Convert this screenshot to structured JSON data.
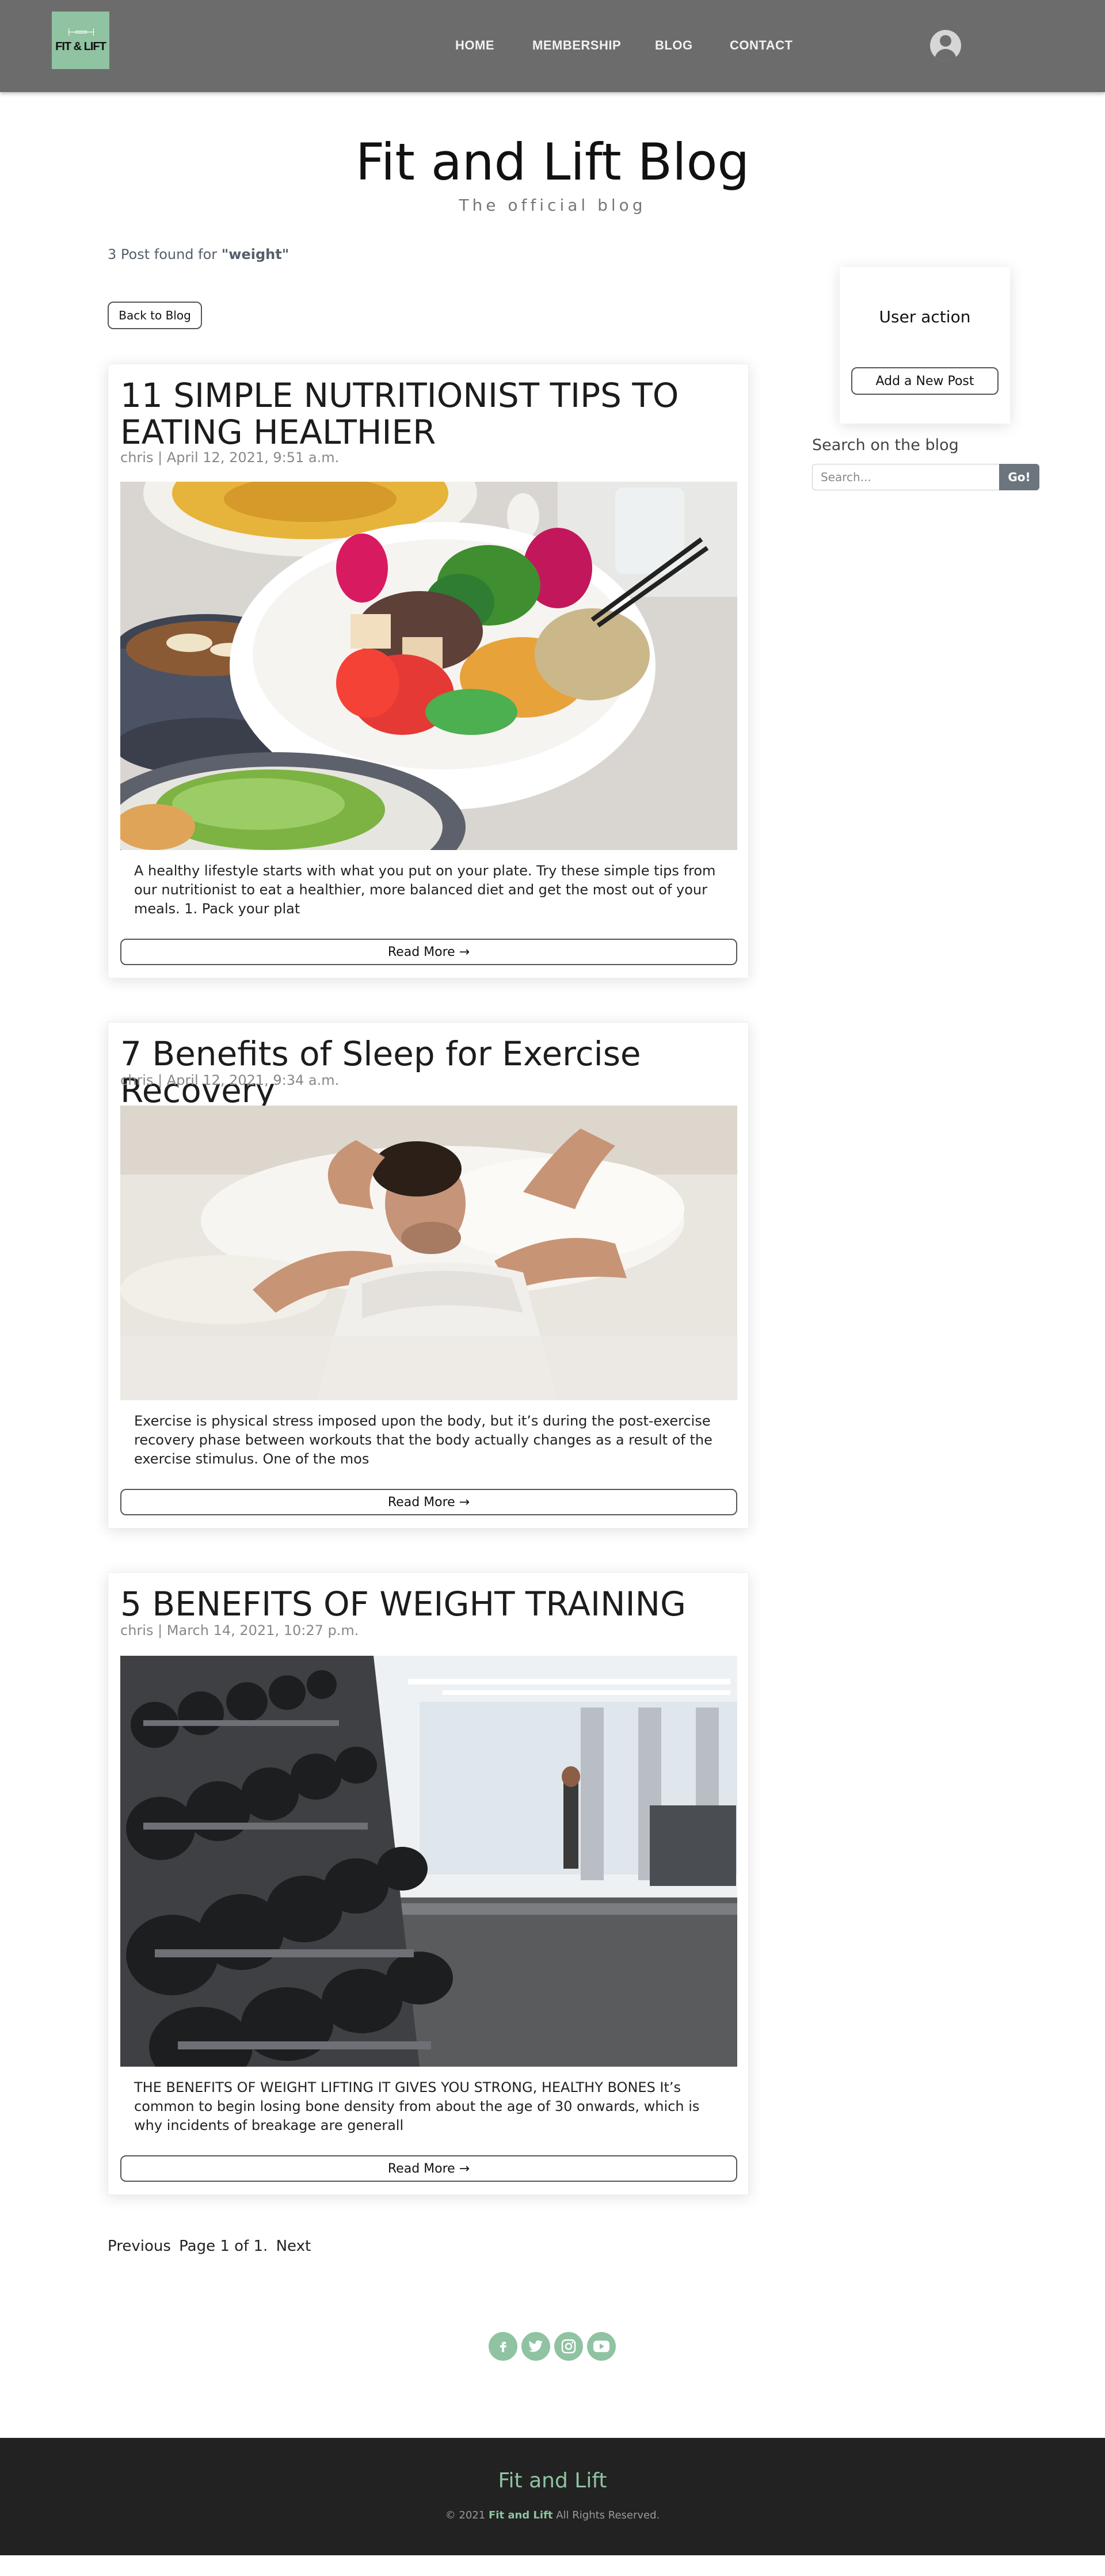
{
  "navbar": {
    "logo_text": "FIT & LIFT",
    "links": [
      "HOME",
      "MEMBERSHIP",
      "BLOG",
      "CONTACT"
    ]
  },
  "header": {
    "title": "Fit and Lift Blog",
    "subtitle": "The official blog"
  },
  "search_result": {
    "prefix": "3 Post found for ",
    "query": "\"weight\""
  },
  "back_button": "Back to Blog",
  "posts": [
    {
      "title": "11 SIMPLE NUTRITIONIST TIPS TO EATING HEALTHIER",
      "meta": "chris | April 12, 2021, 9:51 a.m.",
      "image": "healthy-food-bowls-photo",
      "excerpt": "A healthy lifestyle starts with what you put on your plate. Try these simple tips from our nutritionist to eat a healthier, more balanced diet and get the most out of your meals. 1. Pack your plat",
      "read_more": "Read More →"
    },
    {
      "title": "7 Benefits of Sleep for Exercise Recovery",
      "meta": "chris | April 12, 2021, 9:34 a.m.",
      "image": "man-sleeping-photo",
      "excerpt": "Exercise is physical stress imposed upon the body, but it’s during the post-exercise recovery phase between workouts that the body actually changes as a result of the exercise stimulus. One of the mos",
      "read_more": "Read More →"
    },
    {
      "title": "5 BENEFITS OF WEIGHT TRAINING",
      "meta": "chris | March 14, 2021, 10:27 p.m.",
      "image": "gym-dumbbell-rack-photo",
      "excerpt": "THE BENEFITS OF WEIGHT LIFTING IT GIVES YOU STRONG, HEALTHY BONES It’s common to begin losing bone density from about the age of 30 onwards, which is why incidents of breakage are generall",
      "read_more": "Read More →"
    }
  ],
  "pagination": {
    "previous": "Previous",
    "page_info": "Page 1 of 1.",
    "next": "Next"
  },
  "sidebar": {
    "user_action_title": "User action",
    "add_post_button": "Add a New Post",
    "search_label": "Search on the blog",
    "search_placeholder": "Search...",
    "search_button": "Go!"
  },
  "social": [
    "facebook-icon",
    "twitter-icon",
    "instagram-icon",
    "youtube-icon"
  ],
  "footer": {
    "brand": "Fit and Lift",
    "copy_prefix": "© 2021 ",
    "copy_brand": "Fit and Lift",
    "copy_suffix": " All Rights Reserved."
  },
  "colors": {
    "accent": "#8fc3a1",
    "navbar": "#6c6c6c",
    "footer": "#222222"
  }
}
